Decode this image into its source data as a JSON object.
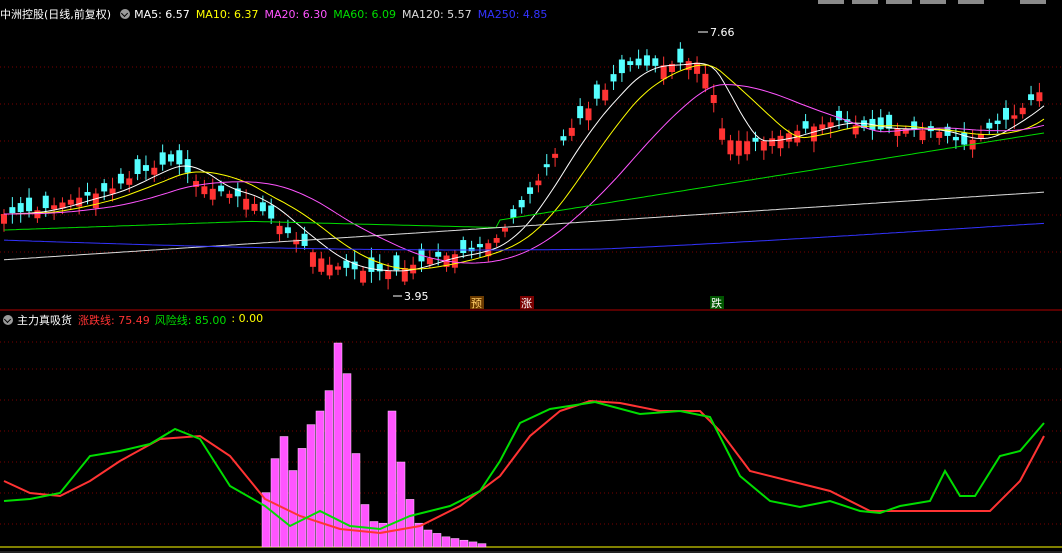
{
  "main_panel": {
    "stock_name": "中洲控股",
    "period_label": "(日线,前复权)",
    "indicators": [
      {
        "label": "MA5: 6.57",
        "color": "#ffffff"
      },
      {
        "label": "MA10: 6.37",
        "color": "#ffff00"
      },
      {
        "label": "MA20: 6.30",
        "color": "#ff55ff"
      },
      {
        "label": "MA60: 6.09",
        "color": "#00dd00"
      },
      {
        "label": "MA120: 5.57",
        "color": "#dddddd"
      },
      {
        "label": "MA250: 4.85",
        "color": "#3333ff"
      }
    ],
    "high_marker": "7.66",
    "low_marker": "3.95",
    "signals": [
      {
        "label": "预",
        "bg": "#6a3a00",
        "color": "#ffcc66"
      },
      {
        "label": "涨",
        "bg": "#7a0000",
        "color": "#ffffff"
      },
      {
        "label": "跌",
        "bg": "#005500",
        "color": "#ffffff"
      }
    ]
  },
  "sub_panel": {
    "title": "主力真吸货",
    "indicators": [
      {
        "label": "涨跌线: 75.49",
        "color": "#ff3333"
      },
      {
        "label": "风险线: 85.00",
        "color": "#00dd00"
      },
      {
        "label": ": 0.00",
        "color": "#ffff00"
      }
    ]
  },
  "colors": {
    "up": "#ff3333",
    "down": "#55ffff",
    "grid": "#7a0000",
    "border": "#b00000",
    "bars": "#ff55ff"
  }
}
